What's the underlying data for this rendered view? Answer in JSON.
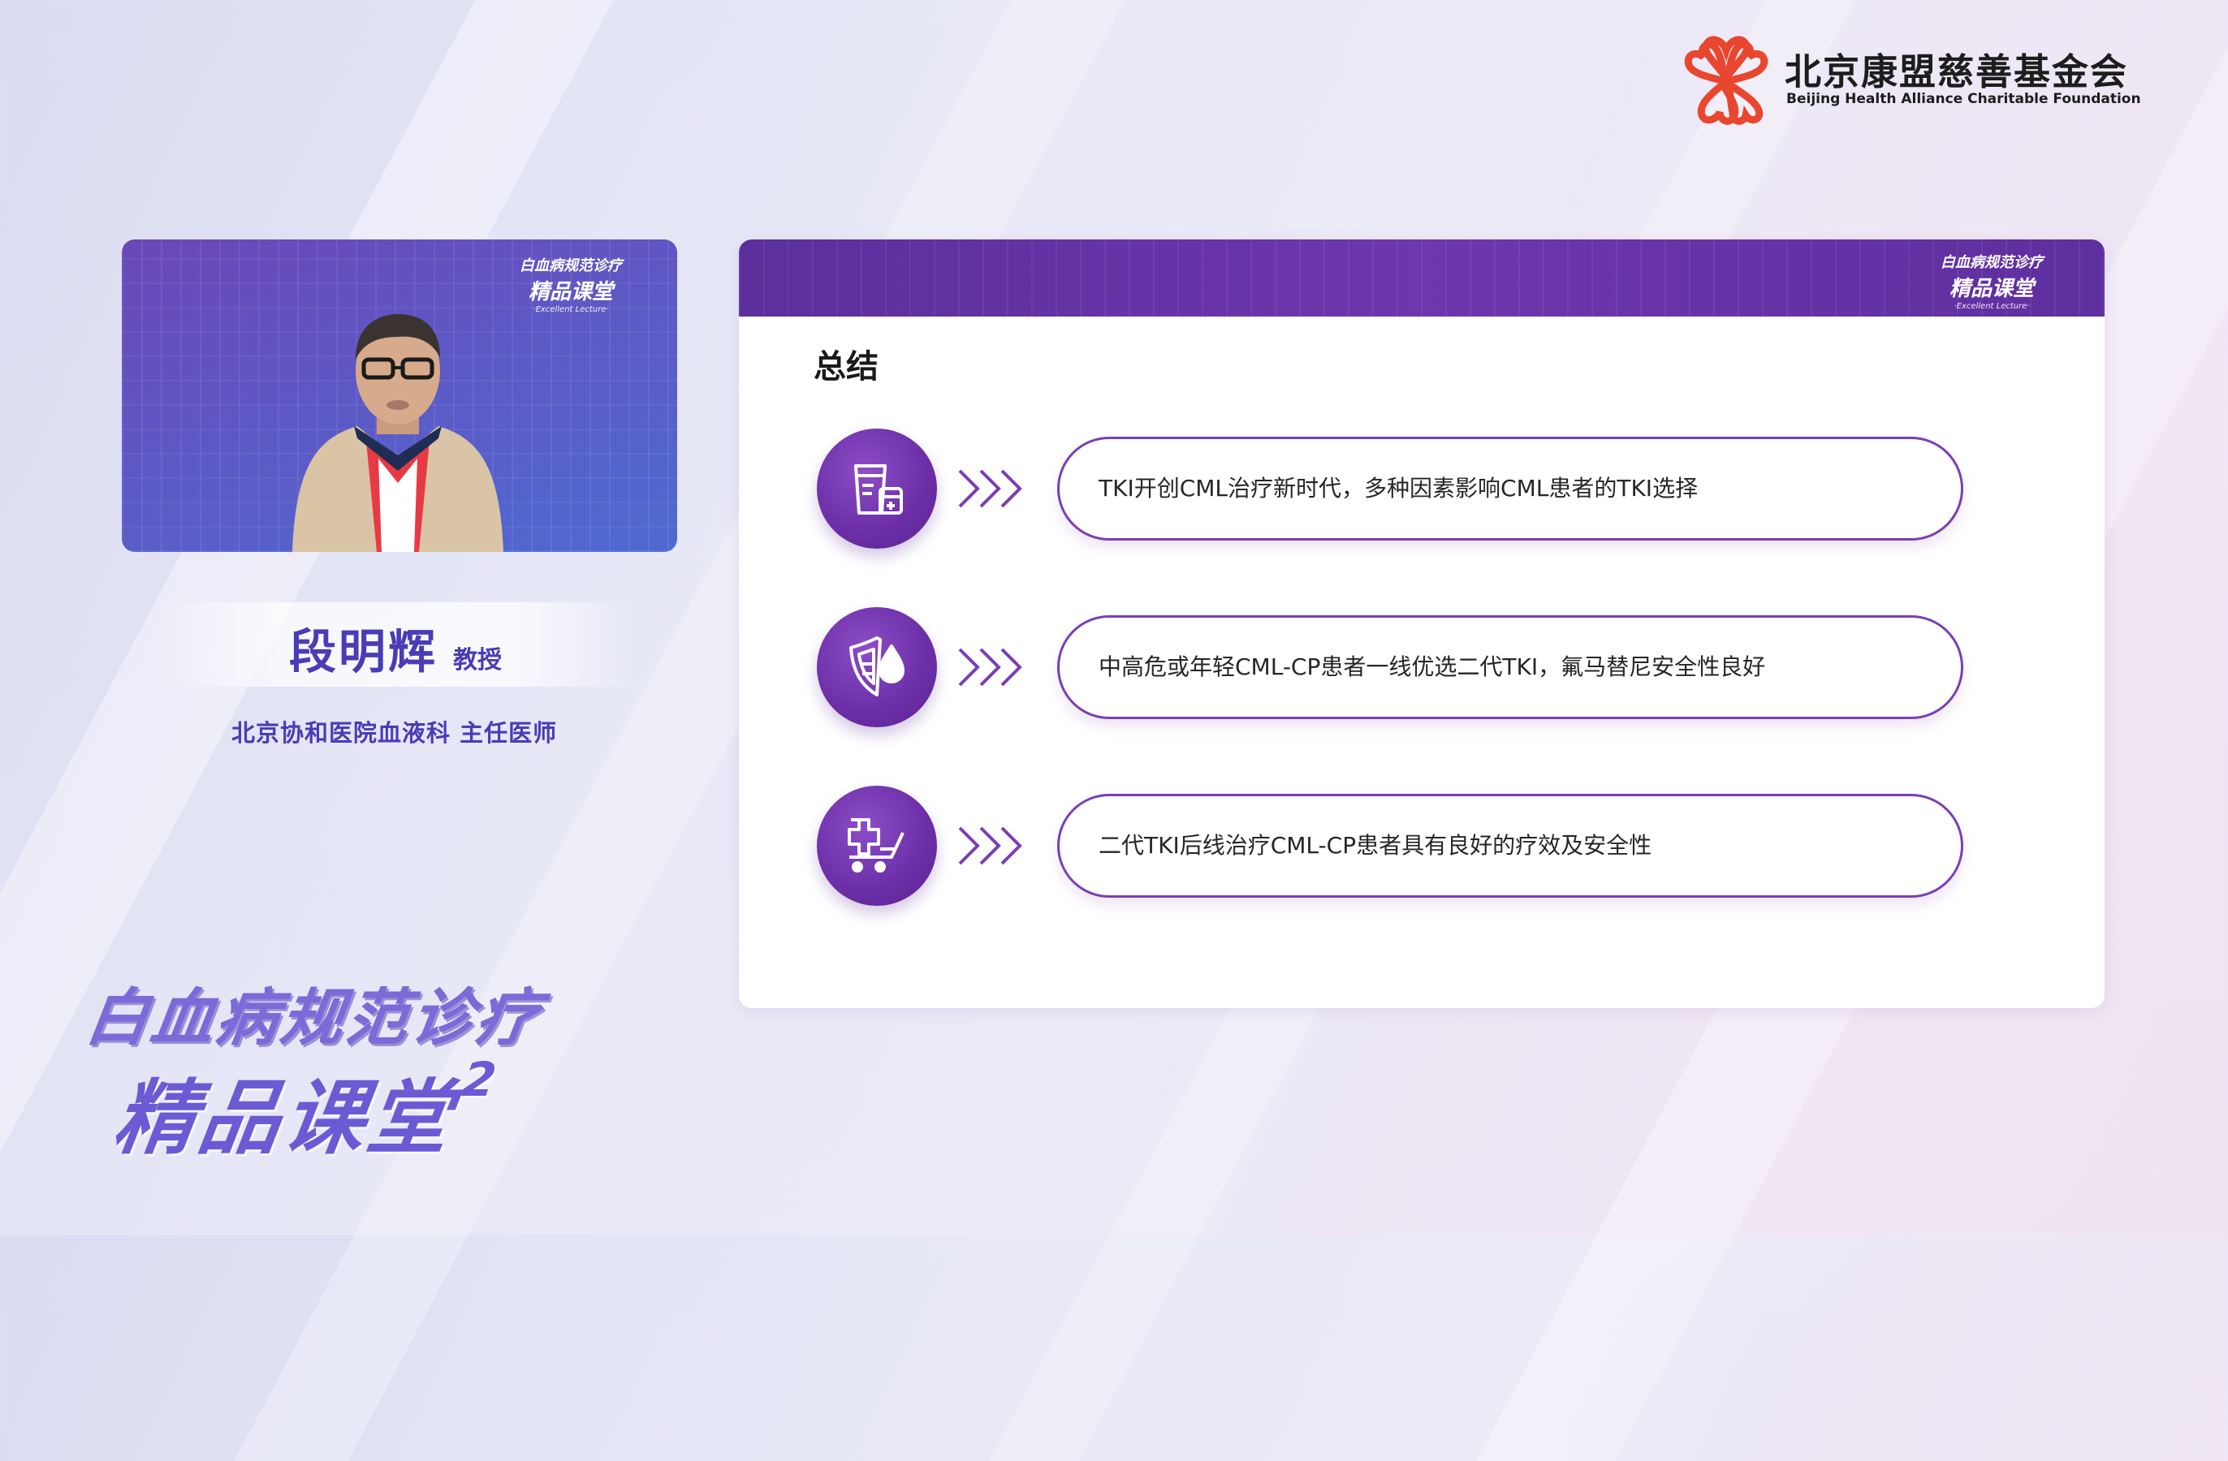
{
  "foundation": {
    "name_cn": "北京康盟慈善基金会",
    "name_en": "Beijing Health Alliance Charitable Foundation"
  },
  "brand": {
    "line1": "白血病规范诊疗",
    "line2": "精品课堂",
    "superscript": "2",
    "subtitle": "·Excellent Lecture·"
  },
  "speaker": {
    "name": "段明辉",
    "title": "教授",
    "affiliation": "北京协和医院血液科   主任医师"
  },
  "slide": {
    "heading": "总结",
    "items": [
      {
        "icon": "medicine-cup-icon",
        "text": "TKI开创CML治疗新时代，多种因素影响CML患者的TKI选择"
      },
      {
        "icon": "shield-drop-icon",
        "text": "中高危或年轻CML-CP患者一线优选二代TKI，氟马替尼安全性良好"
      },
      {
        "icon": "medical-cart-icon",
        "text": "二代TKI后线治疗CML-CP患者具有良好的疗效及安全性"
      }
    ]
  },
  "colors": {
    "accent": "#6b2ea6",
    "name_text": "#4a3cb5",
    "logo_red": "#e8462f"
  }
}
